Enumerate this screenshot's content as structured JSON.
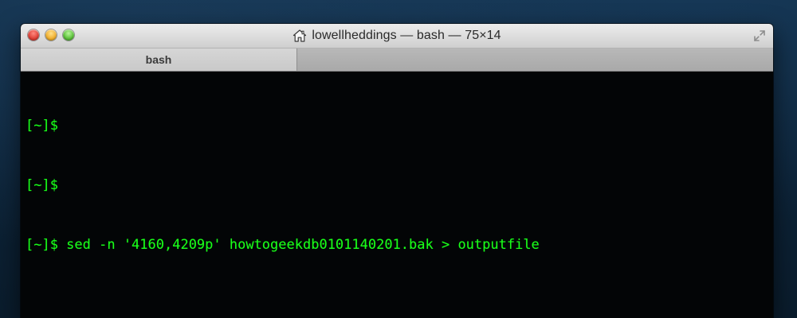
{
  "window": {
    "title": "lowellheddings — bash — 75×14",
    "tab_label": "bash"
  },
  "terminal": {
    "lines": [
      "[~]$",
      "[~]$",
      "[~]$ sed -n '4160,4209p' howtogeekdb0101140201.bak > outputfile"
    ],
    "text_color": "#19ff19",
    "background_color": "#030506"
  },
  "icons": {
    "title_icon": "home-icon",
    "fullscreen_icon": "fullscreen-icon",
    "traffic_lights": [
      "close-button",
      "minimize-button",
      "zoom-button"
    ]
  }
}
